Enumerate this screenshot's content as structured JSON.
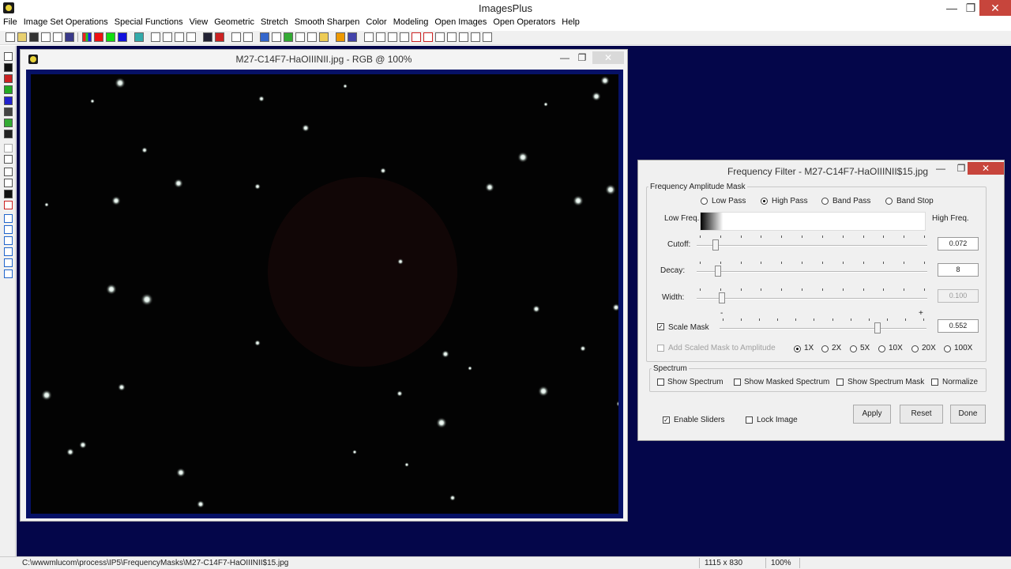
{
  "app": {
    "title": "ImagesPlus"
  },
  "menu": [
    "File",
    "Image Set Operations",
    "Special Functions",
    "View",
    "Geometric",
    "Stretch",
    "Smooth Sharpen",
    "Color",
    "Modeling",
    "Open Images",
    "Open Operators",
    "Help"
  ],
  "image_window": {
    "title": "M27-C14F7-HaOIIINII.jpg - RGB @ 100%"
  },
  "dialog": {
    "title": "Frequency Filter - M27-C14F7-HaOIIINII$15.jpg",
    "amplitude_group": "Frequency Amplitude Mask",
    "filter_types": [
      "Low Pass",
      "High Pass",
      "Band Pass",
      "Band Stop"
    ],
    "selected_filter": "High Pass",
    "low_freq_label": "Low Freq.",
    "high_freq_label": "High Freq.",
    "sliders": [
      {
        "label": "Cutoff:",
        "value": "0.072",
        "level": 0.072,
        "enabled": true
      },
      {
        "label": "Decay:",
        "value": "8",
        "level": 0.08,
        "enabled": true
      },
      {
        "label": "Width:",
        "value": "0.100",
        "level": 0.1,
        "enabled": false
      }
    ],
    "scale_mask": {
      "label": "Scale Mask",
      "checked": true,
      "value": "0.552",
      "level": 0.77,
      "minus": "-",
      "plus": "+"
    },
    "add_scaled_mask": {
      "label": "Add Scaled Mask to Amplitude",
      "checked": false
    },
    "multipliers": [
      "1X",
      "2X",
      "5X",
      "10X",
      "20X",
      "100X"
    ],
    "selected_multiplier": "1X",
    "spectrum_group": "Spectrum",
    "spectrum_options": [
      {
        "label": "Show Spectrum",
        "checked": false
      },
      {
        "label": "Show Masked Spectrum",
        "checked": false
      },
      {
        "label": "Show Spectrum Mask",
        "checked": false
      },
      {
        "label": "Normalize",
        "checked": false
      }
    ],
    "enable_sliders": {
      "label": "Enable Sliders",
      "checked": true
    },
    "lock_image": {
      "label": "Lock Image",
      "checked": false
    },
    "buttons": {
      "apply": "Apply",
      "reset": "Reset",
      "done": "Done"
    }
  },
  "status": {
    "path": "C:\\wwwmlucom\\process\\IP5\\FrequencyMasks\\M27-C14F7-HaOIIINII$15.jpg",
    "dimensions": "1115 x 830",
    "zoom": "100%"
  },
  "colors": {
    "workspace": "#04064a",
    "image_frame": "#061166",
    "close_button": "#c7453c"
  },
  "icons": [
    "minimize-icon",
    "maximize-icon",
    "close-icon",
    "app-icon"
  ]
}
